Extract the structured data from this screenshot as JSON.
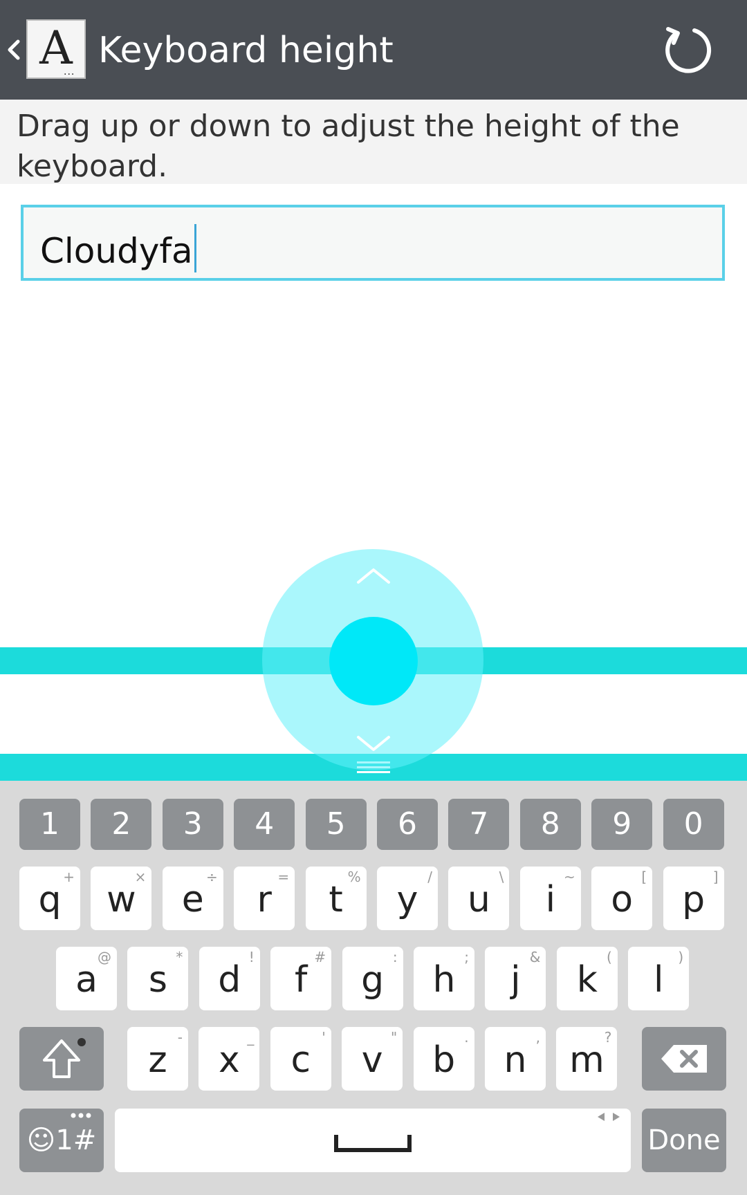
{
  "header": {
    "title": "Keyboard height",
    "app_icon_letter": "A",
    "app_icon_dots": "...",
    "back_icon": "chevron-left-icon",
    "reset_icon": "reset-icon"
  },
  "instruction": "Drag up or down to adjust the height of the keyboard.",
  "input": {
    "value": "Cloudyfa"
  },
  "keyboard": {
    "number_row": [
      "1",
      "2",
      "3",
      "4",
      "5",
      "6",
      "7",
      "8",
      "9",
      "0"
    ],
    "row1": [
      {
        "key": "q",
        "hint": "+"
      },
      {
        "key": "w",
        "hint": "×"
      },
      {
        "key": "e",
        "hint": "÷"
      },
      {
        "key": "r",
        "hint": "="
      },
      {
        "key": "t",
        "hint": "%"
      },
      {
        "key": "y",
        "hint": "/"
      },
      {
        "key": "u",
        "hint": "\\"
      },
      {
        "key": "i",
        "hint": "~"
      },
      {
        "key": "o",
        "hint": "["
      },
      {
        "key": "p",
        "hint": "]"
      }
    ],
    "row2": [
      {
        "key": "a",
        "hint": "@"
      },
      {
        "key": "s",
        "hint": "*"
      },
      {
        "key": "d",
        "hint": "!"
      },
      {
        "key": "f",
        "hint": "#"
      },
      {
        "key": "g",
        "hint": ":"
      },
      {
        "key": "h",
        "hint": ";"
      },
      {
        "key": "j",
        "hint": "&"
      },
      {
        "key": "k",
        "hint": "("
      },
      {
        "key": "l",
        "hint": ")"
      }
    ],
    "row3": [
      {
        "key": "z",
        "hint": "-"
      },
      {
        "key": "x",
        "hint": "_"
      },
      {
        "key": "c",
        "hint": "'"
      },
      {
        "key": "v",
        "hint": "\""
      },
      {
        "key": "b",
        "hint": "."
      },
      {
        "key": "n",
        "hint": ","
      },
      {
        "key": "m",
        "hint": "?"
      }
    ],
    "symbol_key": "☺1#",
    "done_label": "Done",
    "shift_icon": "shift-icon",
    "backspace_icon": "backspace-icon",
    "space_icon": "space-icon"
  },
  "colors": {
    "title_bar": "#4a4e54",
    "accent_band": "#1cdbdb",
    "knob": "#00e8f8",
    "input_border": "#5ad0e8"
  }
}
